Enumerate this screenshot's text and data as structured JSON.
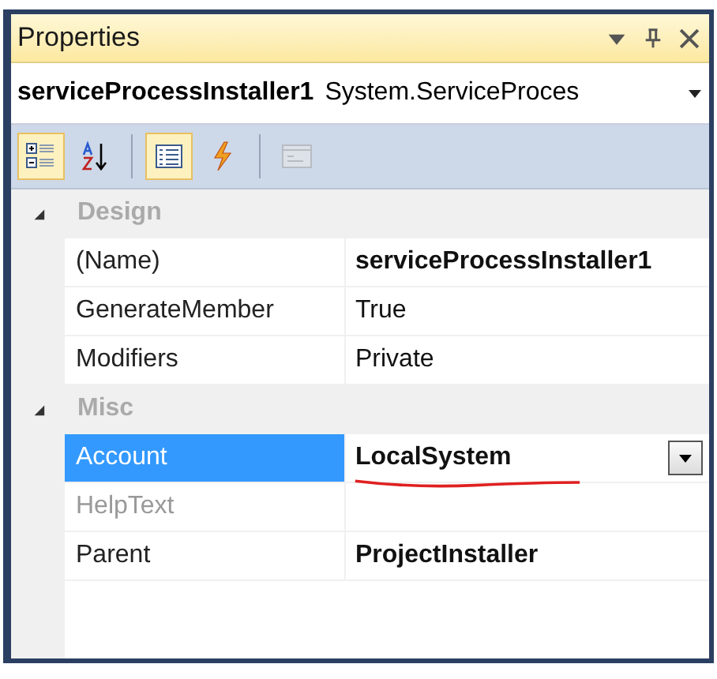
{
  "window": {
    "title": "Properties"
  },
  "object_selector": {
    "name": "serviceProcessInstaller1",
    "type": "System.ServiceProces"
  },
  "toolbar": [
    {
      "kind": "categorized",
      "selected": true,
      "disabled": false
    },
    {
      "kind": "alphabetical",
      "selected": false,
      "disabled": false
    },
    {
      "kind": "separator"
    },
    {
      "kind": "properties",
      "selected": true,
      "disabled": false
    },
    {
      "kind": "events",
      "selected": false,
      "disabled": false
    },
    {
      "kind": "separator"
    },
    {
      "kind": "pages",
      "selected": false,
      "disabled": true
    }
  ],
  "grid": [
    {
      "kind": "category",
      "label": "Design",
      "expanded": true
    },
    {
      "kind": "property",
      "name": "(Name)",
      "value": "serviceProcessInstaller1",
      "modified": true,
      "disabled": false,
      "selected": false
    },
    {
      "kind": "property",
      "name": "GenerateMember",
      "value": "True",
      "modified": false,
      "disabled": false,
      "selected": false
    },
    {
      "kind": "property",
      "name": "Modifiers",
      "value": "Private",
      "modified": false,
      "disabled": false,
      "selected": false
    },
    {
      "kind": "category",
      "label": "Misc",
      "expanded": true
    },
    {
      "kind": "property",
      "name": "Account",
      "value": "LocalSystem",
      "modified": true,
      "disabled": false,
      "selected": true,
      "underlined": true
    },
    {
      "kind": "property",
      "name": "HelpText",
      "disabled": true,
      "selected": false
    },
    {
      "kind": "property",
      "name": "Parent",
      "value": "ProjectInstaller",
      "modified": true,
      "disabled": false,
      "selected": false
    }
  ]
}
